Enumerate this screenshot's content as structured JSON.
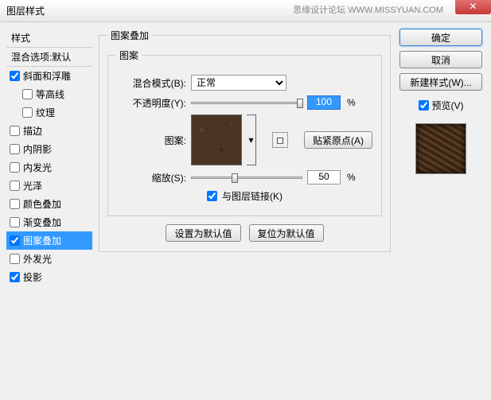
{
  "window": {
    "title": "图层样式",
    "watermark": "思缘设计论坛  WWW.MISSYUAN.COM"
  },
  "left": {
    "header": "样式",
    "subheader": "混合选项:默认",
    "items": [
      {
        "label": "斜面和浮雕",
        "checked": true,
        "indent": false
      },
      {
        "label": "等高线",
        "checked": false,
        "indent": true
      },
      {
        "label": "纹理",
        "checked": false,
        "indent": true
      },
      {
        "label": "描边",
        "checked": false,
        "indent": false
      },
      {
        "label": "内阴影",
        "checked": false,
        "indent": false
      },
      {
        "label": "内发光",
        "checked": false,
        "indent": false
      },
      {
        "label": "光泽",
        "checked": false,
        "indent": false
      },
      {
        "label": "颜色叠加",
        "checked": false,
        "indent": false
      },
      {
        "label": "渐变叠加",
        "checked": false,
        "indent": false
      },
      {
        "label": "图案叠加",
        "checked": true,
        "indent": false,
        "selected": true
      },
      {
        "label": "外发光",
        "checked": false,
        "indent": false
      },
      {
        "label": "投影",
        "checked": true,
        "indent": false
      }
    ]
  },
  "center": {
    "group_title": "图案叠加",
    "inner_title": "图案",
    "blend_label": "混合模式(B):",
    "blend_value": "正常",
    "opacity_label": "不透明度(Y):",
    "opacity_value": "100",
    "pattern_label": "图案:",
    "snap_btn": "贴紧原点(A)",
    "scale_label": "缩放(S):",
    "scale_value": "50",
    "link_label": "与图层链接(K)",
    "make_default": "设置为默认值",
    "reset_default": "复位为默认值",
    "pct": "%"
  },
  "right": {
    "ok": "确定",
    "cancel": "取消",
    "new_style": "新建样式(W)...",
    "preview": "预览(V)"
  }
}
